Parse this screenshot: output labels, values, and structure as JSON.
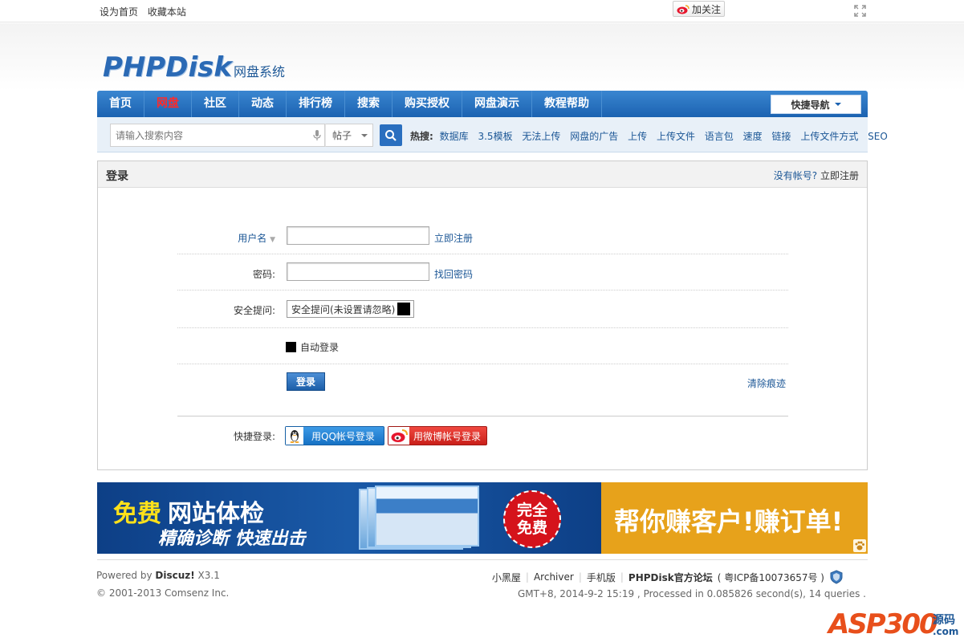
{
  "topbar": {
    "set_home": "设为首页",
    "bookmark": "收藏本站",
    "follow": "加关注"
  },
  "logo": {
    "main": "PHPDisk",
    "sub": "网盘系统"
  },
  "nav": {
    "items": [
      {
        "label": "首页"
      },
      {
        "label": "网盘"
      },
      {
        "label": "社区"
      },
      {
        "label": "动态"
      },
      {
        "label": "排行榜"
      },
      {
        "label": "搜索"
      },
      {
        "label": "购买授权"
      },
      {
        "label": "网盘演示"
      },
      {
        "label": "教程帮助"
      }
    ],
    "active_index": 1,
    "quick_nav": "快捷导航"
  },
  "search": {
    "placeholder": "请输入搜索内容",
    "scope": "帖子",
    "hot_label": "热搜:",
    "hot_keywords": [
      "数据库",
      "3.5模板",
      "无法上传",
      "网盘的广告",
      "上传",
      "上传文件",
      "语言包",
      "速度",
      "链接",
      "上传文件方式",
      "SEO"
    ]
  },
  "login": {
    "title": "登录",
    "no_account": "没有帐号?",
    "register_now": "立即注册",
    "username_label": "用户名",
    "username_value": "",
    "register_link": "立即注册",
    "password_label": "密码:",
    "password_value": "",
    "forgot_link": "找回密码",
    "question_label": "安全提问:",
    "question_value": "安全提问(未设置请忽略)",
    "auto_login": "自动登录",
    "login_button": "登录",
    "clear_link": "清除痕迹",
    "quick_login_label": "快捷登录:",
    "qq_button": "用QQ帐号登录",
    "weibo_button": "用微博帐号登录"
  },
  "banner": {
    "free": "免费",
    "check": "网站体检",
    "subtitle": "精确诊断 快速出击",
    "badge_line1": "完全",
    "badge_line2": "免费",
    "right_text": "帮你赚客户!赚订单!"
  },
  "footer": {
    "powered_prefix": "Powered by ",
    "powered_name": "Discuz!",
    "powered_version": " X3.1",
    "copyright": "© 2001-2013 Comsenz Inc.",
    "links": [
      "小黑屋",
      "Archiver",
      "手机版"
    ],
    "official_forum": "PHPDisk官方论坛",
    "icp": "( 粤ICP备10073657号 )",
    "gmt": "GMT+8, 2014-9-2 15:19 , Processed in 0.085826 second(s), 14 queries ."
  },
  "watermark": {
    "asp": "ASP300",
    "yuan": "源码",
    "com": ".com"
  },
  "colors": {
    "nav_blue": "#1b62b1",
    "link_blue": "#1c5796",
    "active_red": "#ff2a2a",
    "banner_yellow": "#e7a21b"
  }
}
